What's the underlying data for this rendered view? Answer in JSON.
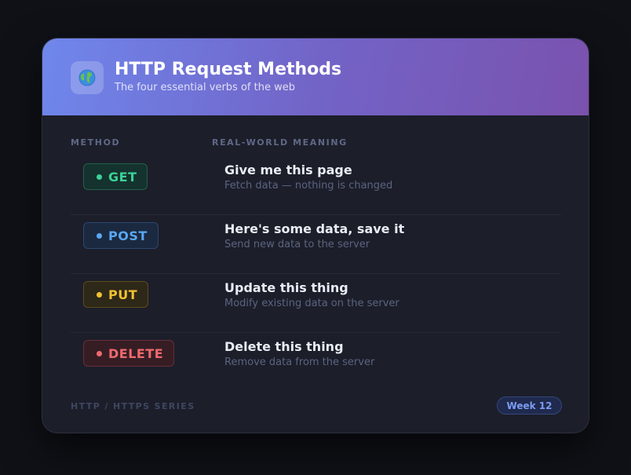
{
  "header": {
    "icon": "globe-icon",
    "title": "HTTP Request Methods",
    "subtitle": "The four essential verbs of the web"
  },
  "columns": {
    "method": "METHOD",
    "meaning": "REAL-WORLD MEANING"
  },
  "methods": [
    {
      "name": "GET",
      "meaning": "Give me this page",
      "description": "Fetch data — nothing is changed",
      "color": "#3dd197"
    },
    {
      "name": "POST",
      "meaning": "Here's some data, save it",
      "description": "Send new data to the server",
      "color": "#5aa7f2"
    },
    {
      "name": "PUT",
      "meaning": "Update this thing",
      "description": "Modify existing data on the server",
      "color": "#f1c232"
    },
    {
      "name": "DELETE",
      "meaning": "Delete this thing",
      "description": "Remove data from the server",
      "color": "#ee6a6e"
    }
  ],
  "footer": {
    "series": "HTTP / HTTPS SERIES",
    "week": "Week 12"
  },
  "colors": {
    "header_gradient_start": "#6f87ec",
    "header_gradient_end": "#7a52ae",
    "card_background": "#1c1e2a",
    "page_background": "#101117"
  }
}
